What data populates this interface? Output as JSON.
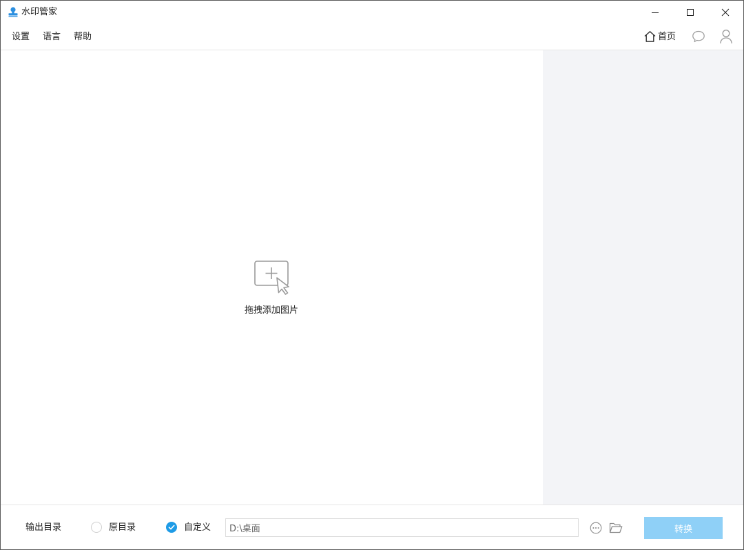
{
  "window": {
    "title": "水印管家",
    "app_icon": "stamp-icon",
    "controls": [
      "minimize-icon",
      "maximize-icon",
      "close-icon"
    ]
  },
  "menubar": {
    "items": [
      {
        "label": "设置"
      },
      {
        "label": "语言"
      },
      {
        "label": "帮助"
      }
    ],
    "home_label": "首页",
    "home_icon": "home-icon",
    "chat_icon": "chat-bubble-icon",
    "user_icon": "user-icon"
  },
  "main": {
    "drop_text": "拖拽添加图片",
    "drop_icon": "add-image-cursor-icon"
  },
  "bottom": {
    "output_label": "输出目录",
    "options": [
      {
        "label": "原目录",
        "selected": false
      },
      {
        "label": "自定义",
        "selected": true
      }
    ],
    "path_value": "D:\\桌面",
    "more_icon": "more-options-icon",
    "folder_icon": "folder-open-icon",
    "convert_label": "转换"
  },
  "colors": {
    "accent": "#1e9be6",
    "convert_button": "#8fd0f7",
    "side_panel": "#f3f4f7",
    "border": "#e6e6e6"
  }
}
